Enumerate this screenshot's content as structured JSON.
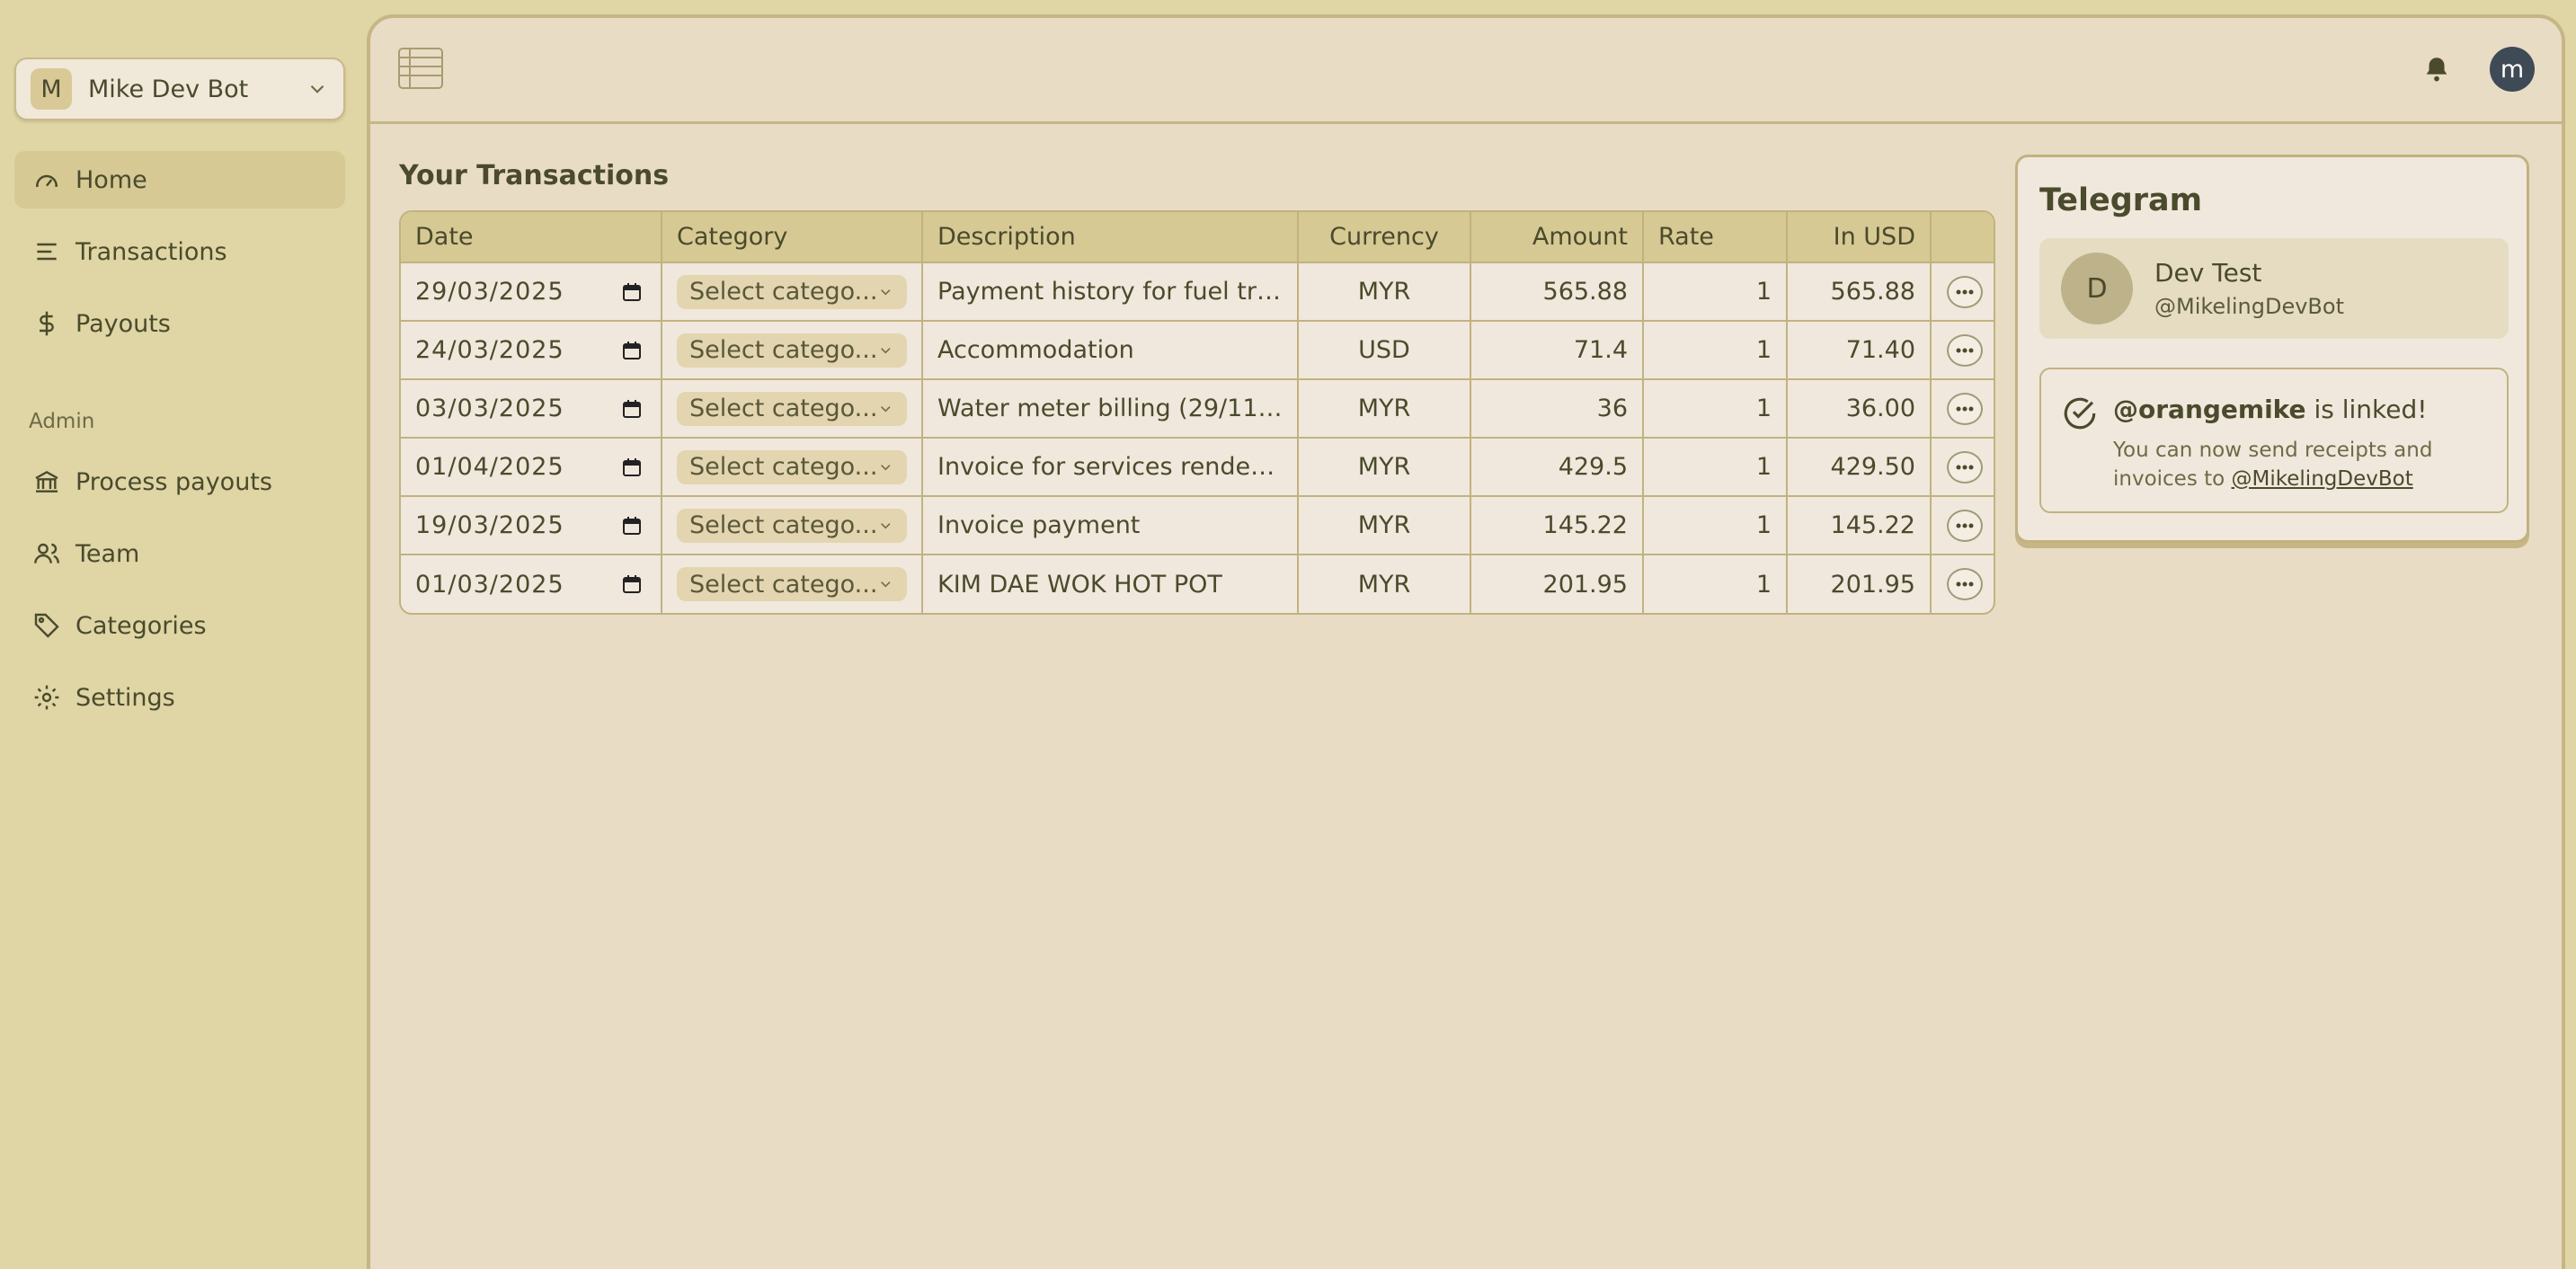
{
  "workspace": {
    "initial": "M",
    "name": "Mike Dev Bot"
  },
  "nav": [
    {
      "label": "Home",
      "icon": "gauge-icon",
      "active": true
    },
    {
      "label": "Transactions",
      "icon": "list-icon"
    },
    {
      "label": "Payouts",
      "icon": "dollar-icon"
    }
  ],
  "admin": {
    "label": "Admin",
    "items": [
      {
        "label": "Process payouts",
        "icon": "bank-icon"
      },
      {
        "label": "Team",
        "icon": "users-icon"
      },
      {
        "label": "Categories",
        "icon": "tag-icon"
      },
      {
        "label": "Settings",
        "icon": "gear-icon"
      }
    ]
  },
  "topbar": {
    "user_initial": "m"
  },
  "transactions": {
    "title": "Your Transactions",
    "columns": [
      "Date",
      "Category",
      "Description",
      "Currency",
      "Amount",
      "Rate",
      "In USD"
    ],
    "rows": [
      {
        "date": "29/03/2025",
        "category": "Select catego...",
        "description": "Payment history for fuel tran...",
        "currency": "MYR",
        "amount": "565.88",
        "rate": "1",
        "usd": "565.88"
      },
      {
        "date": "24/03/2025",
        "category": "Select catego...",
        "description": "Accommodation",
        "currency": "USD",
        "amount": "71.4",
        "rate": "1",
        "usd": "71.40"
      },
      {
        "date": "03/03/2025",
        "category": "Select catego...",
        "description": "Water meter billing (29/11/...",
        "currency": "MYR",
        "amount": "36",
        "rate": "1",
        "usd": "36.00"
      },
      {
        "date": "01/04/2025",
        "category": "Select catego...",
        "description": "Invoice for services rendered...",
        "currency": "MYR",
        "amount": "429.5",
        "rate": "1",
        "usd": "429.50"
      },
      {
        "date": "19/03/2025",
        "category": "Select catego...",
        "description": "Invoice payment",
        "currency": "MYR",
        "amount": "145.22",
        "rate": "1",
        "usd": "145.22"
      },
      {
        "date": "01/03/2025",
        "category": "Select catego...",
        "description": "KIM DAE WOK HOT POT",
        "currency": "MYR",
        "amount": "201.95",
        "rate": "1",
        "usd": "201.95"
      }
    ]
  },
  "telegram": {
    "title": "Telegram",
    "user": {
      "initial": "D",
      "name": "Dev Test",
      "handle": "@MikelingDevBot"
    },
    "linked": {
      "username": "@orangemike",
      "suffix": " is linked!",
      "desc": "You can now send receipts and invoices to ",
      "link": "@MikelingDevBot"
    }
  },
  "colors": {
    "sidebar_bg": "#dfd5a5",
    "panel_bg": "#e8dcc5",
    "accent": "#d6c994",
    "text": "#4a4a2c"
  }
}
